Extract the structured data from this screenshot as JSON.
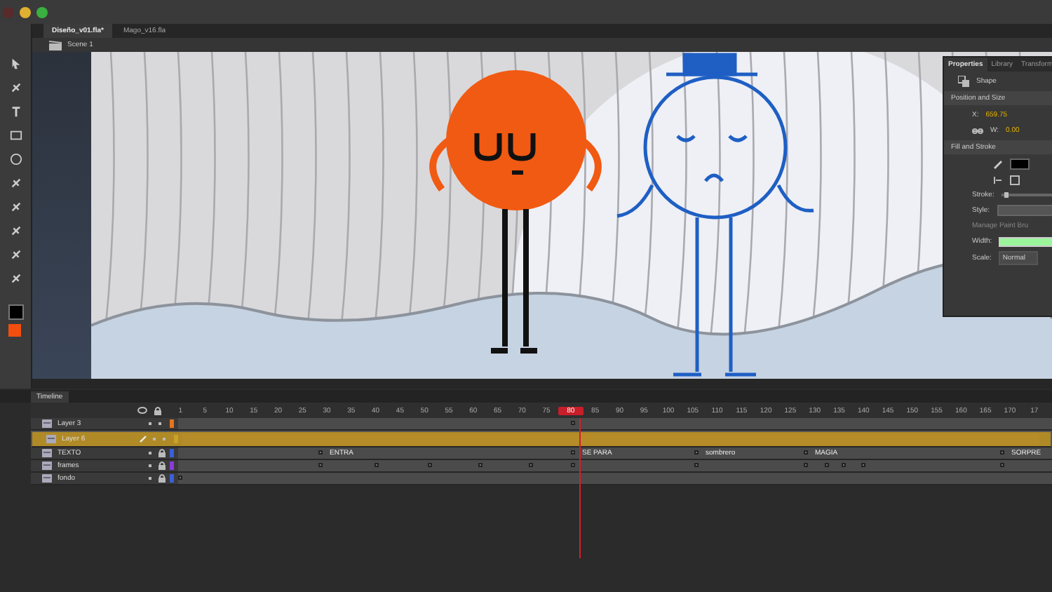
{
  "document_tabs": [
    {
      "label": "Diseño_v01.fla*",
      "selected": true
    },
    {
      "label": "Mago_v16.fla",
      "selected": false
    }
  ],
  "scene": {
    "label": "Scene 1"
  },
  "properties": {
    "tabs": [
      {
        "label": "Properties",
        "selected": true
      },
      {
        "label": "Library",
        "selected": false
      },
      {
        "label": "Transform",
        "selected": false
      }
    ],
    "object_type": "Shape",
    "position_section": "Position and Size",
    "x_label": "X:",
    "x_value": "659.75",
    "w_label": "W:",
    "w_value": "0.00",
    "fill_section": "Fill and Stroke",
    "stroke_label": "Stroke:",
    "stroke_slider": {
      "level": 0.05
    },
    "style_label": "Style:",
    "manage_label": "Manage Paint Bru",
    "width_label": "Width:",
    "scale_label": "Scale:",
    "scale_value": "Normal"
  },
  "timeline": {
    "title": "Timeline",
    "ruler": [
      {
        "label": "1",
        "selected": false
      },
      {
        "label": "5",
        "selected": false
      },
      {
        "label": "10",
        "selected": false
      },
      {
        "label": "15",
        "selected": false
      },
      {
        "label": "20",
        "selected": false
      },
      {
        "label": "25",
        "selected": false
      },
      {
        "label": "30",
        "selected": false
      },
      {
        "label": "35",
        "selected": false
      },
      {
        "label": "40",
        "selected": false
      },
      {
        "label": "45",
        "selected": false
      },
      {
        "label": "50",
        "selected": false
      },
      {
        "label": "55",
        "selected": false
      },
      {
        "label": "60",
        "selected": false
      },
      {
        "label": "65",
        "selected": false
      },
      {
        "label": "70",
        "selected": false
      },
      {
        "label": "75",
        "selected": false
      },
      {
        "label": "80",
        "selected": true
      },
      {
        "label": "85",
        "selected": false
      },
      {
        "label": "90",
        "selected": false
      },
      {
        "label": "95",
        "selected": false
      },
      {
        "label": "100",
        "selected": false
      },
      {
        "label": "105",
        "selected": false
      },
      {
        "label": "110",
        "selected": false
      },
      {
        "label": "115",
        "selected": false
      },
      {
        "label": "120",
        "selected": false
      },
      {
        "label": "125",
        "selected": false
      },
      {
        "label": "130",
        "selected": false
      },
      {
        "label": "135",
        "selected": false
      },
      {
        "label": "140",
        "selected": false
      },
      {
        "label": "145",
        "selected": false
      },
      {
        "label": "150",
        "selected": false
      },
      {
        "label": "155",
        "selected": false
      },
      {
        "label": "160",
        "selected": false
      },
      {
        "label": "165",
        "selected": false
      },
      {
        "label": "170",
        "selected": false
      },
      {
        "label": "17",
        "selected": false
      }
    ],
    "layers": [
      {
        "name": "Layer 3",
        "selected": false,
        "locked": false,
        "color": "#e8731a"
      },
      {
        "name": "Layer 6",
        "selected": true,
        "locked": false,
        "color": "#c9a227"
      },
      {
        "name": "TEXTO",
        "selected": false,
        "locked": true,
        "color": "#3a5fd9",
        "frame_labels": [
          "ENTRA",
          "SE PARA",
          "sombrero",
          "MAGIA",
          "SORPRE"
        ]
      },
      {
        "name": "frames",
        "selected": false,
        "locked": true,
        "color": "#8a3ad9"
      },
      {
        "name": "fondo",
        "selected": false,
        "locked": true,
        "color": "#3a5fd9"
      }
    ]
  }
}
